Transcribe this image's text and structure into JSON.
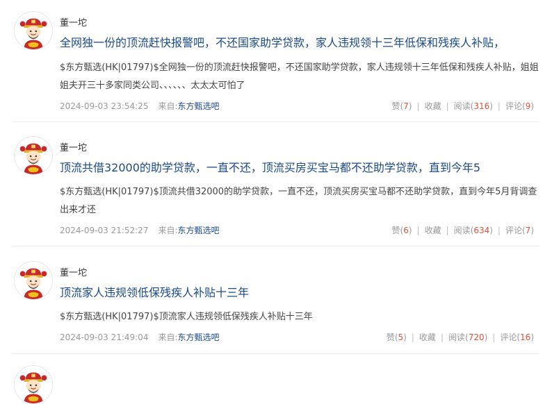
{
  "posts": [
    {
      "author": "董一坨",
      "title": "全网独一份的顶流赶快报警吧，不还国家助学贷款，家人违规领十三年低保和残疾人补贴，",
      "body": "$东方甄选(HK|01797)$全网独一份的顶流赶快报警吧，不还国家助学贷款，家人违规领十三年低保和残疾人补贴，姐姐姐夫开三十多家同类公司、、、、、、太太太可怕了",
      "time": "2024-09-03 23:54:25",
      "source_label": "来自:",
      "source": "东方甄选吧",
      "like_label": "赞",
      "like_count": "7",
      "collect_label": "收藏",
      "read_label": "阅读",
      "read_count": "316",
      "comment_label": "评论",
      "comment_count": "9"
    },
    {
      "author": "董一坨",
      "title": "顶流共借32000的助学贷款，一直不还，顶流买房买宝马都不还助学贷款，直到今年5",
      "body": "$东方甄选(HK|01797)$顶流共借32000的助学贷款，一直不还，顶流买房买宝马都不还助学贷款，直到今年5月背调查出来才还",
      "time": "2024-09-03 21:52:27",
      "source_label": "来自:",
      "source": "东方甄选吧",
      "like_label": "赞",
      "like_count": "6",
      "collect_label": "收藏",
      "read_label": "阅读",
      "read_count": "634",
      "comment_label": "评论",
      "comment_count": "7"
    },
    {
      "author": "董一坨",
      "title": "顶流家人违规领低保残疾人补贴十三年",
      "body": "$东方甄选(HK|01797)$顶流家人违规领低保残疾人补贴十三年",
      "time": "2024-09-03 21:49:04",
      "source_label": "来自:",
      "source": "东方甄选吧",
      "like_label": "赞",
      "like_count": "5",
      "collect_label": "收藏",
      "read_label": "阅读",
      "read_count": "720",
      "comment_label": "评论",
      "comment_count": "16"
    }
  ]
}
